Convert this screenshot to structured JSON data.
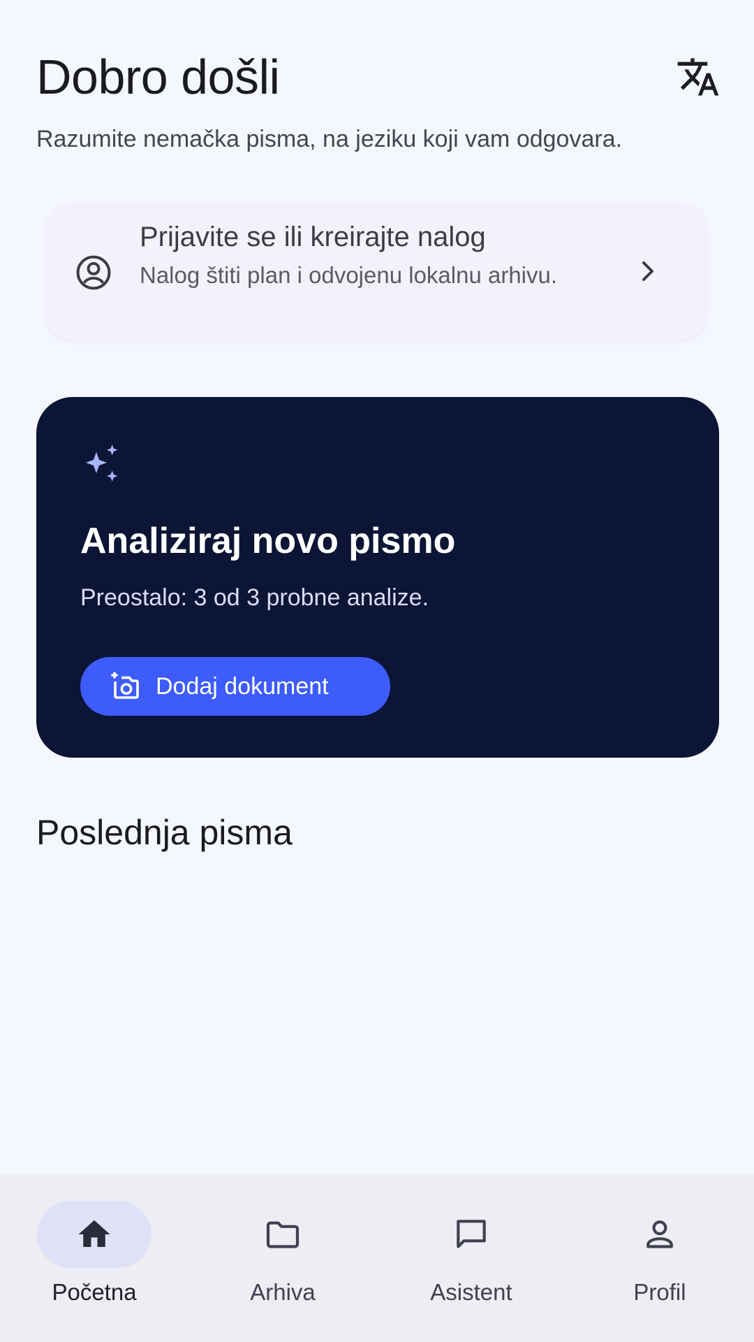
{
  "header": {
    "title": "Dobro došli",
    "translate_icon": "translate-icon"
  },
  "subtitle": "Razumite nemačka pisma, na jeziku koji vam odgovara.",
  "login_card": {
    "icon": "account-circle-icon",
    "title": "Prijavite se ili kreirajte nalog",
    "description": "Nalog štiti plan i odvojenu lokalnu arhivu.",
    "chevron_icon": "chevron-right-icon"
  },
  "hero": {
    "icon": "sparkle-icon",
    "title": "Analiziraj novo pismo",
    "description": "Preostalo: 3 od 3 probne analize.",
    "button": {
      "icon": "add-photo-icon",
      "label": "Dodaj dokument"
    },
    "colors": {
      "background": "#0c1535",
      "button": "#3d5cfb",
      "accent_icon": "#a9b6ff"
    }
  },
  "recent": {
    "title": "Poslednja pisma"
  },
  "bottom_nav": {
    "items": [
      {
        "label": "Početna",
        "icon": "home-icon",
        "active": true
      },
      {
        "label": "Arhiva",
        "icon": "folder-icon",
        "active": false
      },
      {
        "label": "Asistent",
        "icon": "chat-icon",
        "active": false
      },
      {
        "label": "Profil",
        "icon": "person-icon",
        "active": false
      }
    ]
  }
}
